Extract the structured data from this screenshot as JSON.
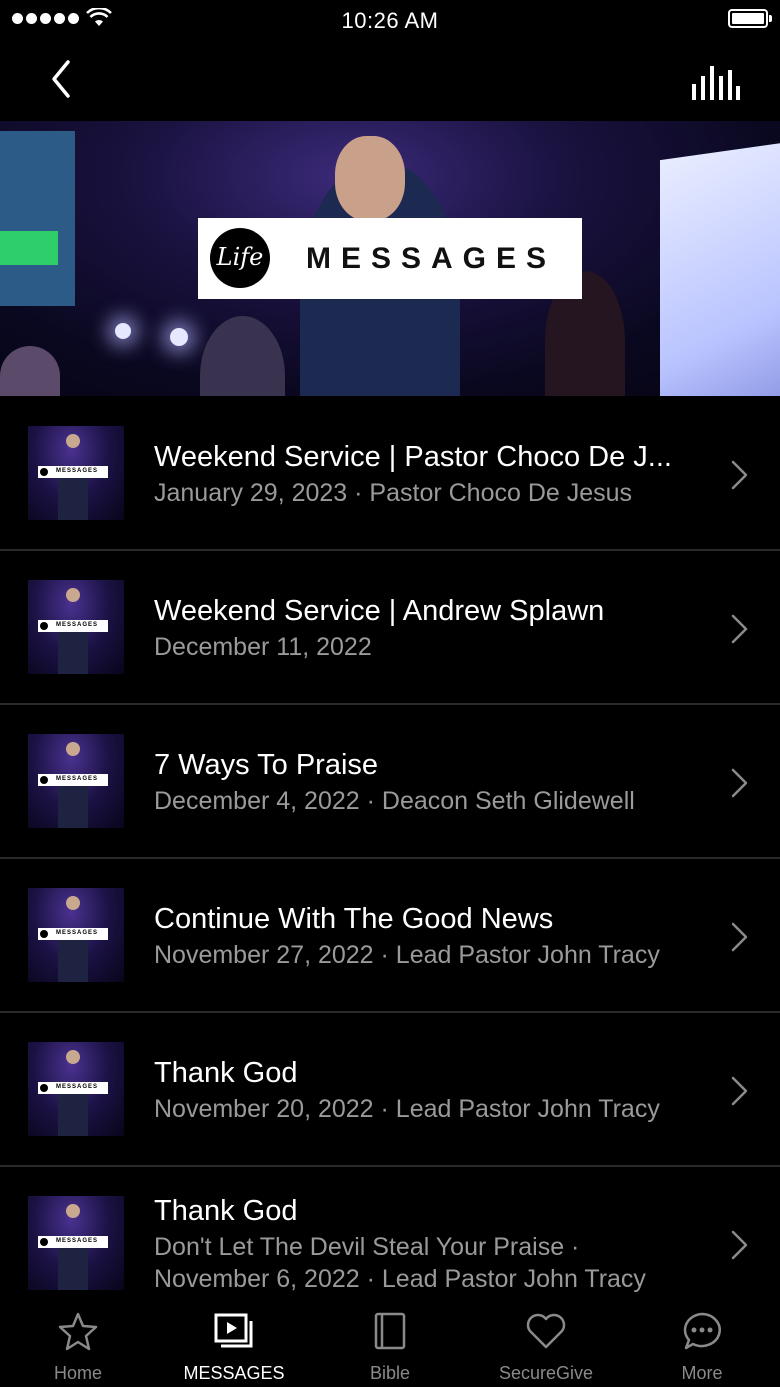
{
  "status_bar": {
    "time": "10:26 AM"
  },
  "nav": {
    "back_icon": "chevron-left-icon",
    "audio_icon": "audio-bars-icon"
  },
  "hero": {
    "logo_word": "Life",
    "logo_text": "MESSAGES"
  },
  "thumb_logo_text": "MESSAGES",
  "messages": [
    {
      "title": "Weekend Service | Pastor Choco De J...",
      "subtitle": "January 29, 2023 · Pastor Choco De Jesus"
    },
    {
      "title": "Weekend Service | Andrew Splawn",
      "subtitle": "December 11, 2022"
    },
    {
      "title": "7 Ways To Praise",
      "subtitle": "December 4, 2022 · Deacon Seth Glidewell"
    },
    {
      "title": "Continue With The Good News",
      "subtitle": "November 27, 2022 · Lead Pastor John Tracy"
    },
    {
      "title": "Thank God",
      "subtitle": "November 20, 2022 · Lead Pastor John Tracy"
    },
    {
      "title": "Thank God",
      "subtitle": "Don't Let The Devil Steal Your Praise ·",
      "subtitle2": "November 6, 2022 · Lead Pastor John Tracy"
    }
  ],
  "tabs": [
    {
      "label": "Home",
      "icon": "star-icon"
    },
    {
      "label": "MESSAGES",
      "icon": "media-icon",
      "active": true
    },
    {
      "label": "Bible",
      "icon": "book-icon"
    },
    {
      "label": "SecureGive",
      "icon": "heart-icon"
    },
    {
      "label": "More",
      "icon": "chat-bubble-icon"
    }
  ],
  "colors": {
    "background": "#000000",
    "text": "#ffffff",
    "secondary_text": "#9a9a9a",
    "divider": "#2a2a2a",
    "inactive_tab": "#8a8a8a"
  }
}
